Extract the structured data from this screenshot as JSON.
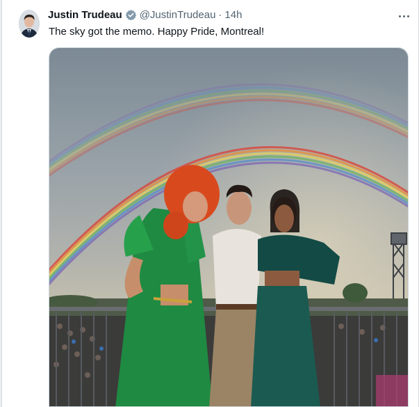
{
  "tweet": {
    "author_name": "Justin Trudeau",
    "handle": "@JustinTrudeau",
    "separator": "·",
    "time": "14h",
    "text": "The sky got the memo. Happy Pride, Montreal!"
  },
  "icons": {
    "verified": "verified-badge-icon",
    "more": "more-options-icon"
  },
  "colors": {
    "verified_badge": "#829aab",
    "secondary_text": "#536471"
  }
}
